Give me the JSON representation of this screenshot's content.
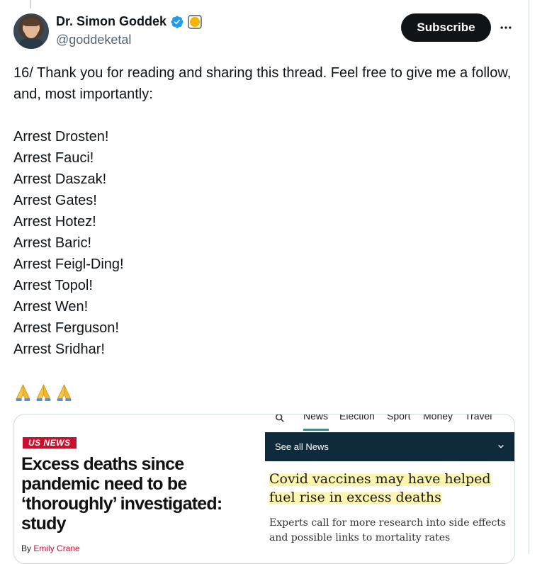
{
  "author": {
    "display_name": "Dr. Simon Goddek",
    "handle": "@goddeketal"
  },
  "actions": {
    "subscribe_label": "Subscribe"
  },
  "tweet": {
    "intro": "16/ Thank you for reading and sharing this thread. Feel free to give me a follow, and, most importantly:",
    "arrests": [
      "Arrest Drosten!",
      "Arrest Fauci!",
      "Arrest Daszak!",
      "Arrest Gates!",
      "Arrest Hotez!",
      "Arrest Baric!",
      "Arrest Feigl-Ding!",
      "Arrest Topol!",
      "Arrest Wen!",
      "Arrest Ferguson!",
      "Arrest Sridhar!"
    ],
    "emoji_icon": "folded-hands-icon"
  },
  "media": {
    "left": {
      "tag": "US NEWS",
      "headline": "Excess deaths since pandemic need to be ‘thoroughly’ investigated: study",
      "byline_prefix": "By",
      "byline_author": "Emily Crane",
      "tag_color": "#c8102e"
    },
    "right": {
      "nav_items": [
        "News",
        "Election",
        "Sport",
        "Money",
        "Travel"
      ],
      "see_all": "See all News",
      "headline": "Covid vaccines may have helped fuel rise in excess deaths",
      "standfirst": "Experts call for more research into side effects and possible links to mortality rates",
      "bar_color": "#0e2a3b",
      "highlight_color": "#fbf5b0"
    }
  },
  "colors": {
    "text": "#0f1419",
    "secondary": "#536471",
    "verified": "#1d9bf0"
  }
}
